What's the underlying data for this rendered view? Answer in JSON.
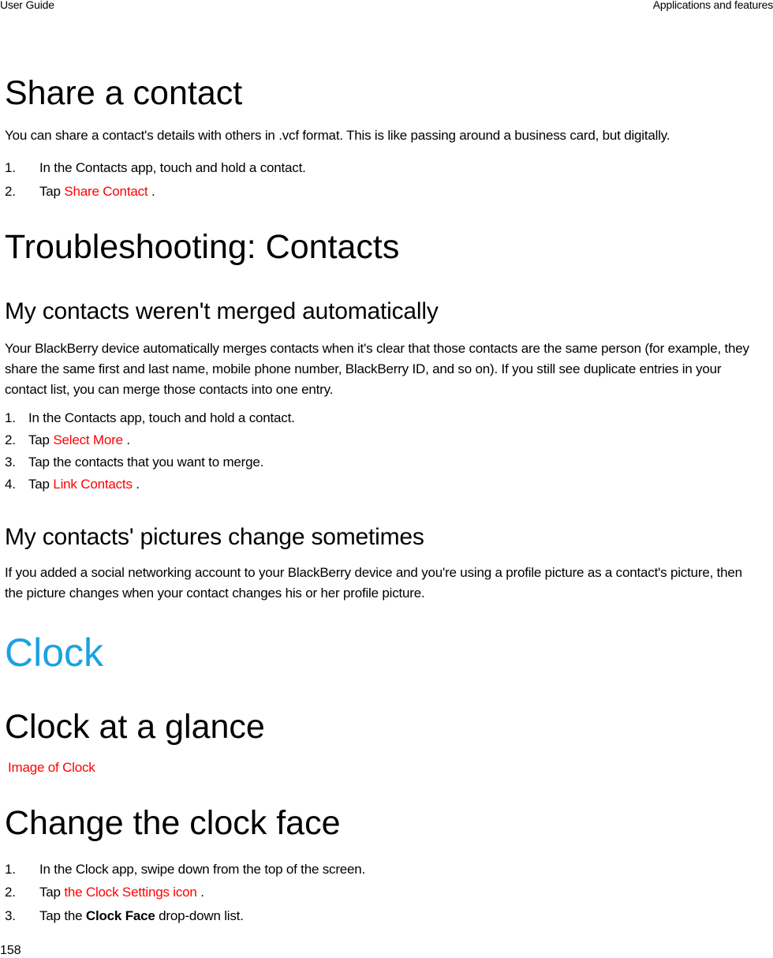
{
  "header": {
    "left": "User Guide",
    "right": "Applications and features"
  },
  "colors": {
    "text": "#000000",
    "uicontrol": "#ff0000",
    "chapter_heading": "#1ba1e2"
  },
  "share_contact": {
    "title": "Share a contact",
    "intro": "You can share a contact's details with others in .vcf format. This is like passing around a business card, but digitally.",
    "steps": [
      {
        "num": "1.",
        "text": "In the Contacts app, touch and hold a contact."
      },
      {
        "num": "2.",
        "prefix": "Tap ",
        "control": "Share Contact",
        "suffix": " ."
      }
    ]
  },
  "troubleshooting": {
    "title": "Troubleshooting: Contacts",
    "not_merged": {
      "title": "My contacts weren't merged automatically",
      "body": "Your BlackBerry device automatically merges contacts when it's clear that those contacts are the same person (for example, they share the same first and last name, mobile phone number, BlackBerry ID, and so on). If you still see duplicate entries in your contact list, you can merge those contacts into one entry.",
      "steps": [
        {
          "num": "1.",
          "text": "In the Contacts app, touch and hold a contact."
        },
        {
          "num": "2.",
          "prefix": "Tap ",
          "control": "Select More",
          "suffix": " ."
        },
        {
          "num": "3.",
          "text": "Tap the contacts that you want to merge."
        },
        {
          "num": "4.",
          "prefix": "Tap ",
          "control": "Link Contacts",
          "suffix": " ."
        }
      ]
    },
    "pictures_change": {
      "title": "My contacts' pictures change sometimes",
      "body": "If you added a social networking account to your BlackBerry device and you're using a profile picture as a contact's picture, then the picture changes when your contact changes his or her profile picture."
    }
  },
  "clock": {
    "chapter_title": "Clock",
    "at_a_glance": {
      "title": "Clock at a glance",
      "image_placeholder": "Image of Clock"
    },
    "change_face": {
      "title": "Change the clock face",
      "steps": [
        {
          "num": "1.",
          "text": "In the Clock app, swipe down from the top of the screen."
        },
        {
          "num": "2.",
          "prefix": "Tap ",
          "control": "the Clock Settings icon",
          "suffix": " ."
        },
        {
          "num": "3.",
          "prefix": "Tap the ",
          "bold": "Clock Face",
          "suffix": " drop-down list."
        }
      ]
    }
  },
  "footer": {
    "page_number": "158"
  }
}
